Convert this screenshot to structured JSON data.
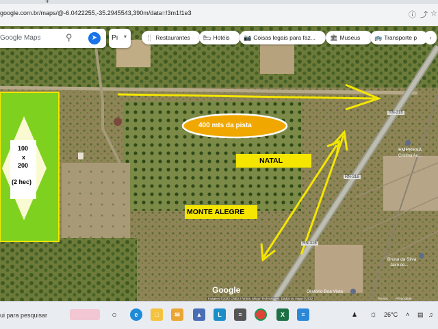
{
  "browser": {
    "url": "google.com.br/maps/@-6.0422255,-35.2945543,390m/data=!3m1!1e3",
    "new_tab_glyph": "+"
  },
  "search": {
    "placeholder": "Google Maps",
    "layers_label": "Pı"
  },
  "chips": [
    {
      "icon": "🍴",
      "label": "Restaurantes"
    },
    {
      "icon": "🛏",
      "label": "Hotéis"
    },
    {
      "icon": "📷",
      "label": "Coisas legais para faz..."
    },
    {
      "icon": "🏛",
      "label": "Museus"
    },
    {
      "icon": "🚌",
      "label": "Transporte p"
    }
  ],
  "annotations": {
    "distance_label": "400 mts da pista",
    "natal_label": "NATAL",
    "monte_alegre_label": "MONTE ALEGRE",
    "lot_size": "100",
    "lot_x": "x",
    "lot_size2": "200",
    "lot_area": "(2 hec)"
  },
  "map_labels": {
    "road_1": "RN-316",
    "road_2": "RN-316",
    "road_3": "RN-316",
    "poi_1": "EMPRESA",
    "poi_1_sub": "Cristina Au...",
    "poi_2": "Bruna da Silva",
    "poi_2_sub": "Jairo de...",
    "poi_3": "Oratório Boa Vista",
    "google_logo": "Google",
    "attribution": "Imagens ©2022 CNES / Airbus, Maxar Technologies, Dados do mapa ©2022",
    "terms": "Termos",
    "privacy": "Privacidade"
  },
  "colors": {
    "arrow": "#f5e600",
    "lot_fill": "#7fd11f",
    "oval_fill": "#f0a800",
    "label_box": "#f5e600"
  },
  "taskbar": {
    "search_text": "ui para pesquisar",
    "weather": "26°C",
    "icons": [
      "task-view",
      "edge",
      "file-explorer",
      "mail",
      "learn",
      "calculator",
      "chrome",
      "excel",
      "notes"
    ]
  }
}
